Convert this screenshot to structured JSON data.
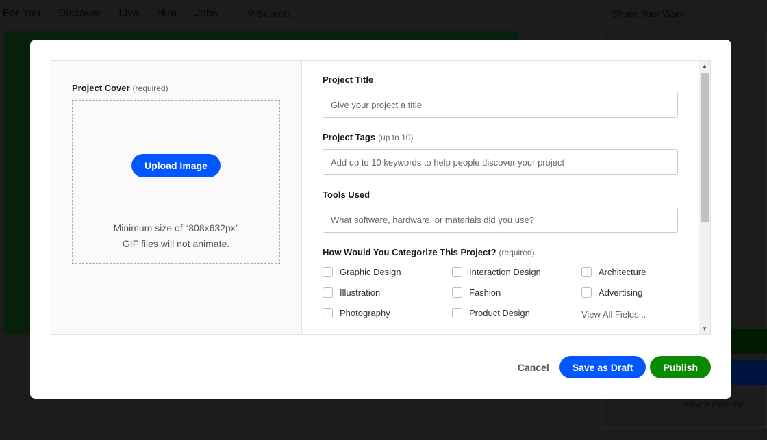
{
  "nav": {
    "items": [
      "For You",
      "Discover",
      "Live",
      "Hire",
      "Jobs"
    ],
    "search_placeholder": "Search...",
    "share": "Share Your Work",
    "sidebar_text": "View a Preview"
  },
  "cover": {
    "label": "Project Cover",
    "required": "(required)",
    "upload": "Upload Image",
    "hint1": "Minimum size of “808x632px”",
    "hint2": "GIF files will not animate."
  },
  "form": {
    "title": {
      "label": "Project Title",
      "placeholder": "Give your project a title"
    },
    "tags": {
      "label": "Project Tags",
      "note": "(up to 10)",
      "placeholder": "Add up to 10 keywords to help people discover your project"
    },
    "tools": {
      "label": "Tools Used",
      "placeholder": "What software, hardware, or materials did you use?"
    },
    "categories": {
      "label": "How Would You Categorize This Project?",
      "required": "(required)",
      "options": [
        "Graphic Design",
        "Interaction Design",
        "Architecture",
        "Illustration",
        "Fashion",
        "Advertising",
        "Photography",
        "Product Design"
      ],
      "view_all": "View All Fields..."
    }
  },
  "footer": {
    "cancel": "Cancel",
    "draft": "Save as Draft",
    "publish": "Publish"
  },
  "colors": {
    "primary": "#0057ff",
    "publish": "#0a8a00"
  }
}
